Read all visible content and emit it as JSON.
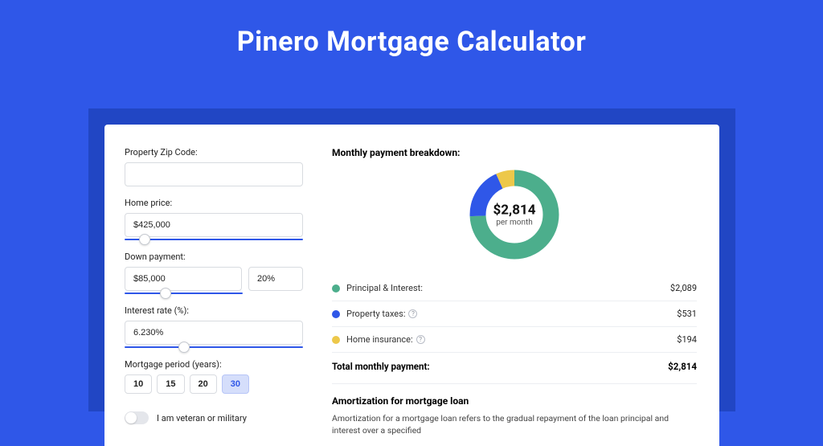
{
  "page": {
    "title": "Pinero Mortgage Calculator"
  },
  "form": {
    "zip": {
      "label": "Property Zip Code:",
      "value": ""
    },
    "home_price": {
      "label": "Home price:",
      "value": "$425,000",
      "slider_pct": 8
    },
    "down_payment": {
      "label": "Down payment:",
      "amount": "$85,000",
      "pct": "20%",
      "slider_pct": 20
    },
    "interest": {
      "label": "Interest rate (%):",
      "value": "6.230%",
      "slider_pct": 30
    },
    "period": {
      "label": "Mortgage period (years):",
      "options": [
        "10",
        "15",
        "20",
        "30"
      ],
      "selected": "30"
    },
    "veteran": {
      "label": "I am veteran or military",
      "checked": false
    }
  },
  "breakdown": {
    "title": "Monthly payment breakdown:",
    "center_amount": "$2,814",
    "center_sub": "per month",
    "items": [
      {
        "label": "Principal & Interest:",
        "value": "$2,089",
        "color": "#4cae8c",
        "info": false
      },
      {
        "label": "Property taxes:",
        "value": "$531",
        "color": "#2f57e8",
        "info": true
      },
      {
        "label": "Home insurance:",
        "value": "$194",
        "color": "#edc84a",
        "info": true
      }
    ],
    "total_label": "Total monthly payment:",
    "total_value": "$2,814"
  },
  "chart_data": {
    "type": "pie",
    "title": "Monthly payment breakdown",
    "series": [
      {
        "name": "Principal & Interest",
        "value": 2089,
        "color": "#4cae8c"
      },
      {
        "name": "Property taxes",
        "value": 531,
        "color": "#2f57e8"
      },
      {
        "name": "Home insurance",
        "value": 194,
        "color": "#edc84a"
      }
    ],
    "total": 2814,
    "unit": "USD per month"
  },
  "amortization": {
    "title": "Amortization for mortgage loan",
    "text": "Amortization for a mortgage loan refers to the gradual repayment of the loan principal and interest over a specified"
  }
}
